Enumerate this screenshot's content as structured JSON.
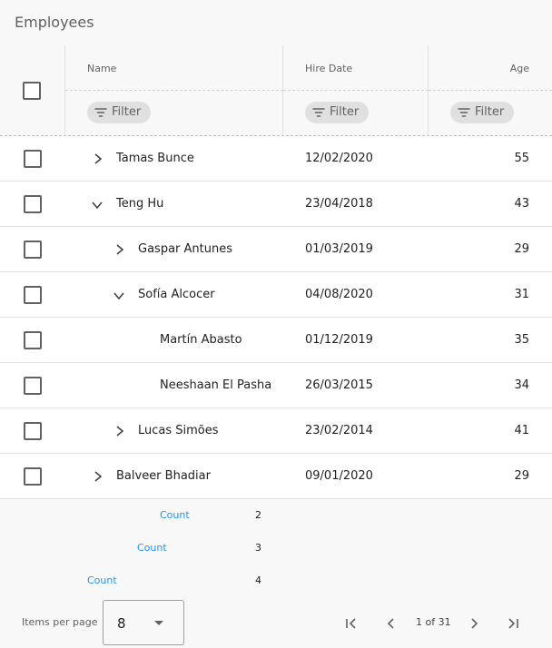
{
  "grid": {
    "title": "Employees",
    "columns": {
      "name": "Name",
      "hire_date": "Hire Date",
      "age": "Age"
    },
    "filter_label": "Filter",
    "rows": [
      {
        "name": "Tamas Bunce",
        "hire_date": "12/02/2020",
        "age": "55",
        "level": 0,
        "expander": "chevron-right"
      },
      {
        "name": "Teng Hu",
        "hire_date": "23/04/2018",
        "age": "43",
        "level": 0,
        "expander": "chevron-down"
      },
      {
        "name": "Gaspar Antunes",
        "hire_date": "01/03/2019",
        "age": "29",
        "level": 1,
        "expander": "chevron-right"
      },
      {
        "name": "Sofía Alcocer",
        "hire_date": "04/08/2020",
        "age": "31",
        "level": 1,
        "expander": "chevron-down"
      },
      {
        "name": "Martín Abasto",
        "hire_date": "01/12/2019",
        "age": "35",
        "level": 2,
        "expander": "none"
      },
      {
        "name": "Neeshaan El Pasha",
        "hire_date": "26/03/2015",
        "age": "34",
        "level": 2,
        "expander": "none"
      },
      {
        "name": "Lucas Simões",
        "hire_date": "23/02/2014",
        "age": "41",
        "level": 1,
        "expander": "chevron-right"
      },
      {
        "name": "Balveer Bhadiar",
        "hire_date": "09/01/2020",
        "age": "29",
        "level": 0,
        "expander": "chevron-right"
      }
    ],
    "summaries": [
      {
        "label": "Count",
        "value": "2",
        "level": 2
      },
      {
        "label": "Count",
        "value": "3",
        "level": 1
      },
      {
        "label": "Count",
        "value": "4",
        "level": 0
      }
    ]
  },
  "paginator": {
    "items_per_page_label": "Items per page",
    "items_per_page": "8",
    "page_text": "1 of 31"
  },
  "colors": {
    "accent": "#2196f3",
    "header_bg": "#f8f8f8",
    "border": "#e0e0e0"
  }
}
